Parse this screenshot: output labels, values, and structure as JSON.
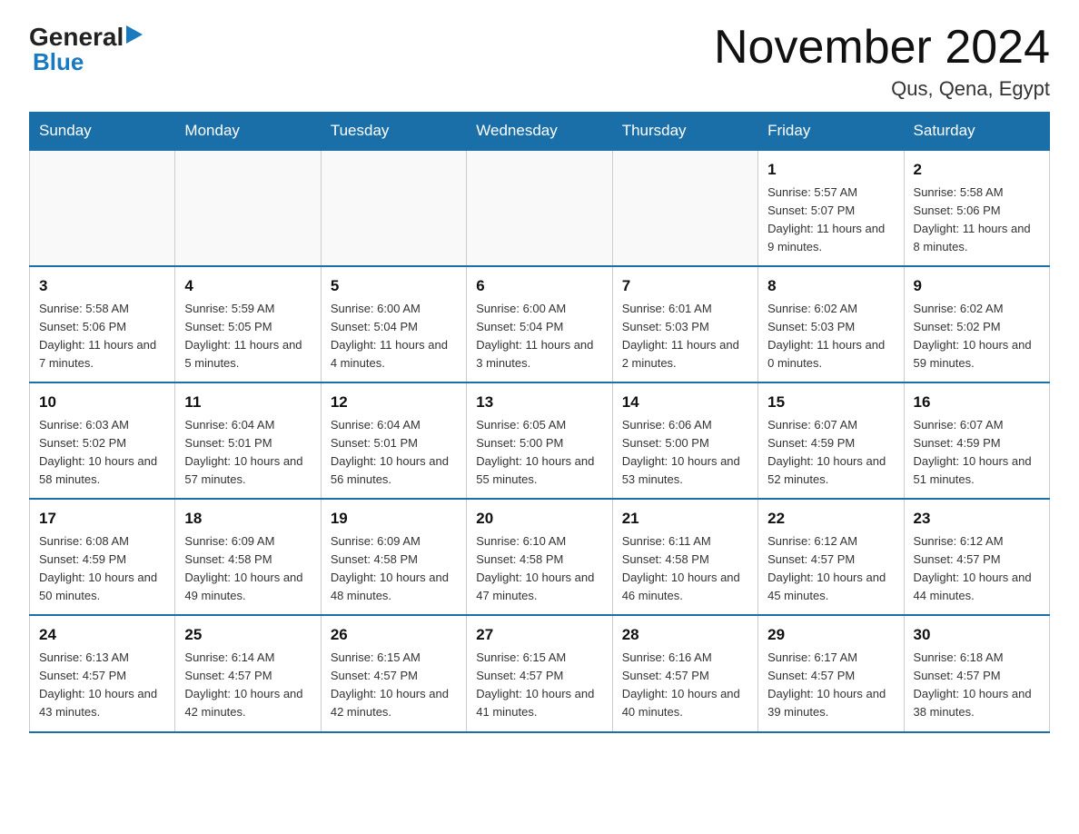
{
  "logo": {
    "line1": "General",
    "triangle": "▶",
    "line2": "Blue"
  },
  "title": "November 2024",
  "subtitle": "Qus, Qena, Egypt",
  "days_of_week": [
    "Sunday",
    "Monday",
    "Tuesday",
    "Wednesday",
    "Thursday",
    "Friday",
    "Saturday"
  ],
  "weeks": [
    [
      {
        "day": "",
        "info": ""
      },
      {
        "day": "",
        "info": ""
      },
      {
        "day": "",
        "info": ""
      },
      {
        "day": "",
        "info": ""
      },
      {
        "day": "",
        "info": ""
      },
      {
        "day": "1",
        "info": "Sunrise: 5:57 AM\nSunset: 5:07 PM\nDaylight: 11 hours and 9 minutes."
      },
      {
        "day": "2",
        "info": "Sunrise: 5:58 AM\nSunset: 5:06 PM\nDaylight: 11 hours and 8 minutes."
      }
    ],
    [
      {
        "day": "3",
        "info": "Sunrise: 5:58 AM\nSunset: 5:06 PM\nDaylight: 11 hours and 7 minutes."
      },
      {
        "day": "4",
        "info": "Sunrise: 5:59 AM\nSunset: 5:05 PM\nDaylight: 11 hours and 5 minutes."
      },
      {
        "day": "5",
        "info": "Sunrise: 6:00 AM\nSunset: 5:04 PM\nDaylight: 11 hours and 4 minutes."
      },
      {
        "day": "6",
        "info": "Sunrise: 6:00 AM\nSunset: 5:04 PM\nDaylight: 11 hours and 3 minutes."
      },
      {
        "day": "7",
        "info": "Sunrise: 6:01 AM\nSunset: 5:03 PM\nDaylight: 11 hours and 2 minutes."
      },
      {
        "day": "8",
        "info": "Sunrise: 6:02 AM\nSunset: 5:03 PM\nDaylight: 11 hours and 0 minutes."
      },
      {
        "day": "9",
        "info": "Sunrise: 6:02 AM\nSunset: 5:02 PM\nDaylight: 10 hours and 59 minutes."
      }
    ],
    [
      {
        "day": "10",
        "info": "Sunrise: 6:03 AM\nSunset: 5:02 PM\nDaylight: 10 hours and 58 minutes."
      },
      {
        "day": "11",
        "info": "Sunrise: 6:04 AM\nSunset: 5:01 PM\nDaylight: 10 hours and 57 minutes."
      },
      {
        "day": "12",
        "info": "Sunrise: 6:04 AM\nSunset: 5:01 PM\nDaylight: 10 hours and 56 minutes."
      },
      {
        "day": "13",
        "info": "Sunrise: 6:05 AM\nSunset: 5:00 PM\nDaylight: 10 hours and 55 minutes."
      },
      {
        "day": "14",
        "info": "Sunrise: 6:06 AM\nSunset: 5:00 PM\nDaylight: 10 hours and 53 minutes."
      },
      {
        "day": "15",
        "info": "Sunrise: 6:07 AM\nSunset: 4:59 PM\nDaylight: 10 hours and 52 minutes."
      },
      {
        "day": "16",
        "info": "Sunrise: 6:07 AM\nSunset: 4:59 PM\nDaylight: 10 hours and 51 minutes."
      }
    ],
    [
      {
        "day": "17",
        "info": "Sunrise: 6:08 AM\nSunset: 4:59 PM\nDaylight: 10 hours and 50 minutes."
      },
      {
        "day": "18",
        "info": "Sunrise: 6:09 AM\nSunset: 4:58 PM\nDaylight: 10 hours and 49 minutes."
      },
      {
        "day": "19",
        "info": "Sunrise: 6:09 AM\nSunset: 4:58 PM\nDaylight: 10 hours and 48 minutes."
      },
      {
        "day": "20",
        "info": "Sunrise: 6:10 AM\nSunset: 4:58 PM\nDaylight: 10 hours and 47 minutes."
      },
      {
        "day": "21",
        "info": "Sunrise: 6:11 AM\nSunset: 4:58 PM\nDaylight: 10 hours and 46 minutes."
      },
      {
        "day": "22",
        "info": "Sunrise: 6:12 AM\nSunset: 4:57 PM\nDaylight: 10 hours and 45 minutes."
      },
      {
        "day": "23",
        "info": "Sunrise: 6:12 AM\nSunset: 4:57 PM\nDaylight: 10 hours and 44 minutes."
      }
    ],
    [
      {
        "day": "24",
        "info": "Sunrise: 6:13 AM\nSunset: 4:57 PM\nDaylight: 10 hours and 43 minutes."
      },
      {
        "day": "25",
        "info": "Sunrise: 6:14 AM\nSunset: 4:57 PM\nDaylight: 10 hours and 42 minutes."
      },
      {
        "day": "26",
        "info": "Sunrise: 6:15 AM\nSunset: 4:57 PM\nDaylight: 10 hours and 42 minutes."
      },
      {
        "day": "27",
        "info": "Sunrise: 6:15 AM\nSunset: 4:57 PM\nDaylight: 10 hours and 41 minutes."
      },
      {
        "day": "28",
        "info": "Sunrise: 6:16 AM\nSunset: 4:57 PM\nDaylight: 10 hours and 40 minutes."
      },
      {
        "day": "29",
        "info": "Sunrise: 6:17 AM\nSunset: 4:57 PM\nDaylight: 10 hours and 39 minutes."
      },
      {
        "day": "30",
        "info": "Sunrise: 6:18 AM\nSunset: 4:57 PM\nDaylight: 10 hours and 38 minutes."
      }
    ]
  ]
}
